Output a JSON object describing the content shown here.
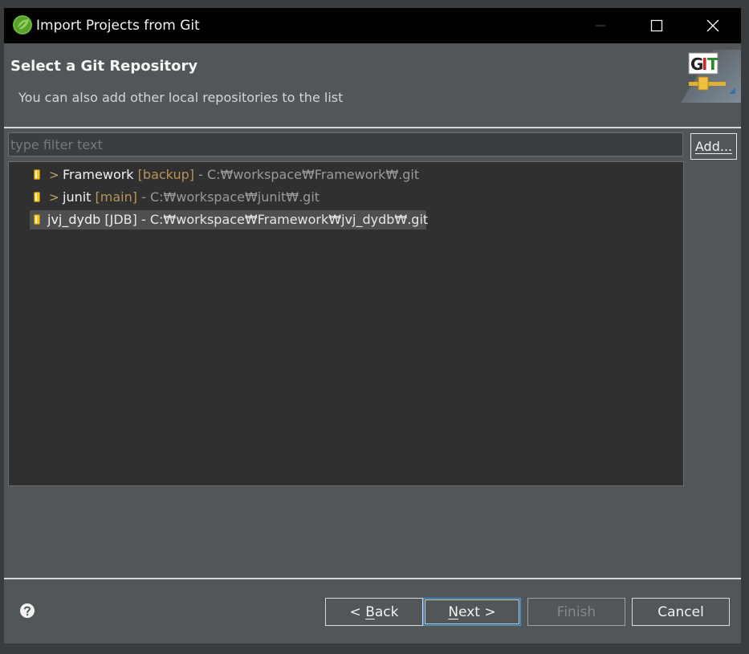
{
  "window": {
    "title": "Import Projects from Git",
    "icon": "spring-leaf-icon"
  },
  "header": {
    "title": "Select a Git Repository",
    "subtitle": "You can also add other local repositories to the list",
    "banner_text": "GIT"
  },
  "filter": {
    "placeholder": "type filter text",
    "value": ""
  },
  "add_button": {
    "label_mnemonic": "A",
    "label_rest": "dd..."
  },
  "repositories": [
    {
      "expandable": true,
      "arrow": ">",
      "name": "Framework",
      "branch": "[backup]",
      "path": "- C:₩workspace₩Framework₩.git",
      "selected": false
    },
    {
      "expandable": true,
      "arrow": ">",
      "name": "junit",
      "branch": "[main]",
      "path": "- C:₩workspace₩junit₩.git",
      "selected": false
    },
    {
      "expandable": false,
      "arrow": "",
      "name": "jvj_dydb",
      "branch": "[JDB]",
      "path": "- C:₩workspace₩Framework₩jvj_dydb₩.git",
      "selected": true
    }
  ],
  "buttons": {
    "back": {
      "prefix": "< ",
      "mnemonic": "B",
      "rest": "ack"
    },
    "next": {
      "mnemonic": "N",
      "rest": "ext >"
    },
    "finish": {
      "label": "Finish",
      "enabled": false
    },
    "cancel": {
      "label": "Cancel"
    }
  },
  "colors": {
    "branch": "#b7945b",
    "path": "#9a9a9a",
    "next_focus": "#4a9ad9"
  }
}
